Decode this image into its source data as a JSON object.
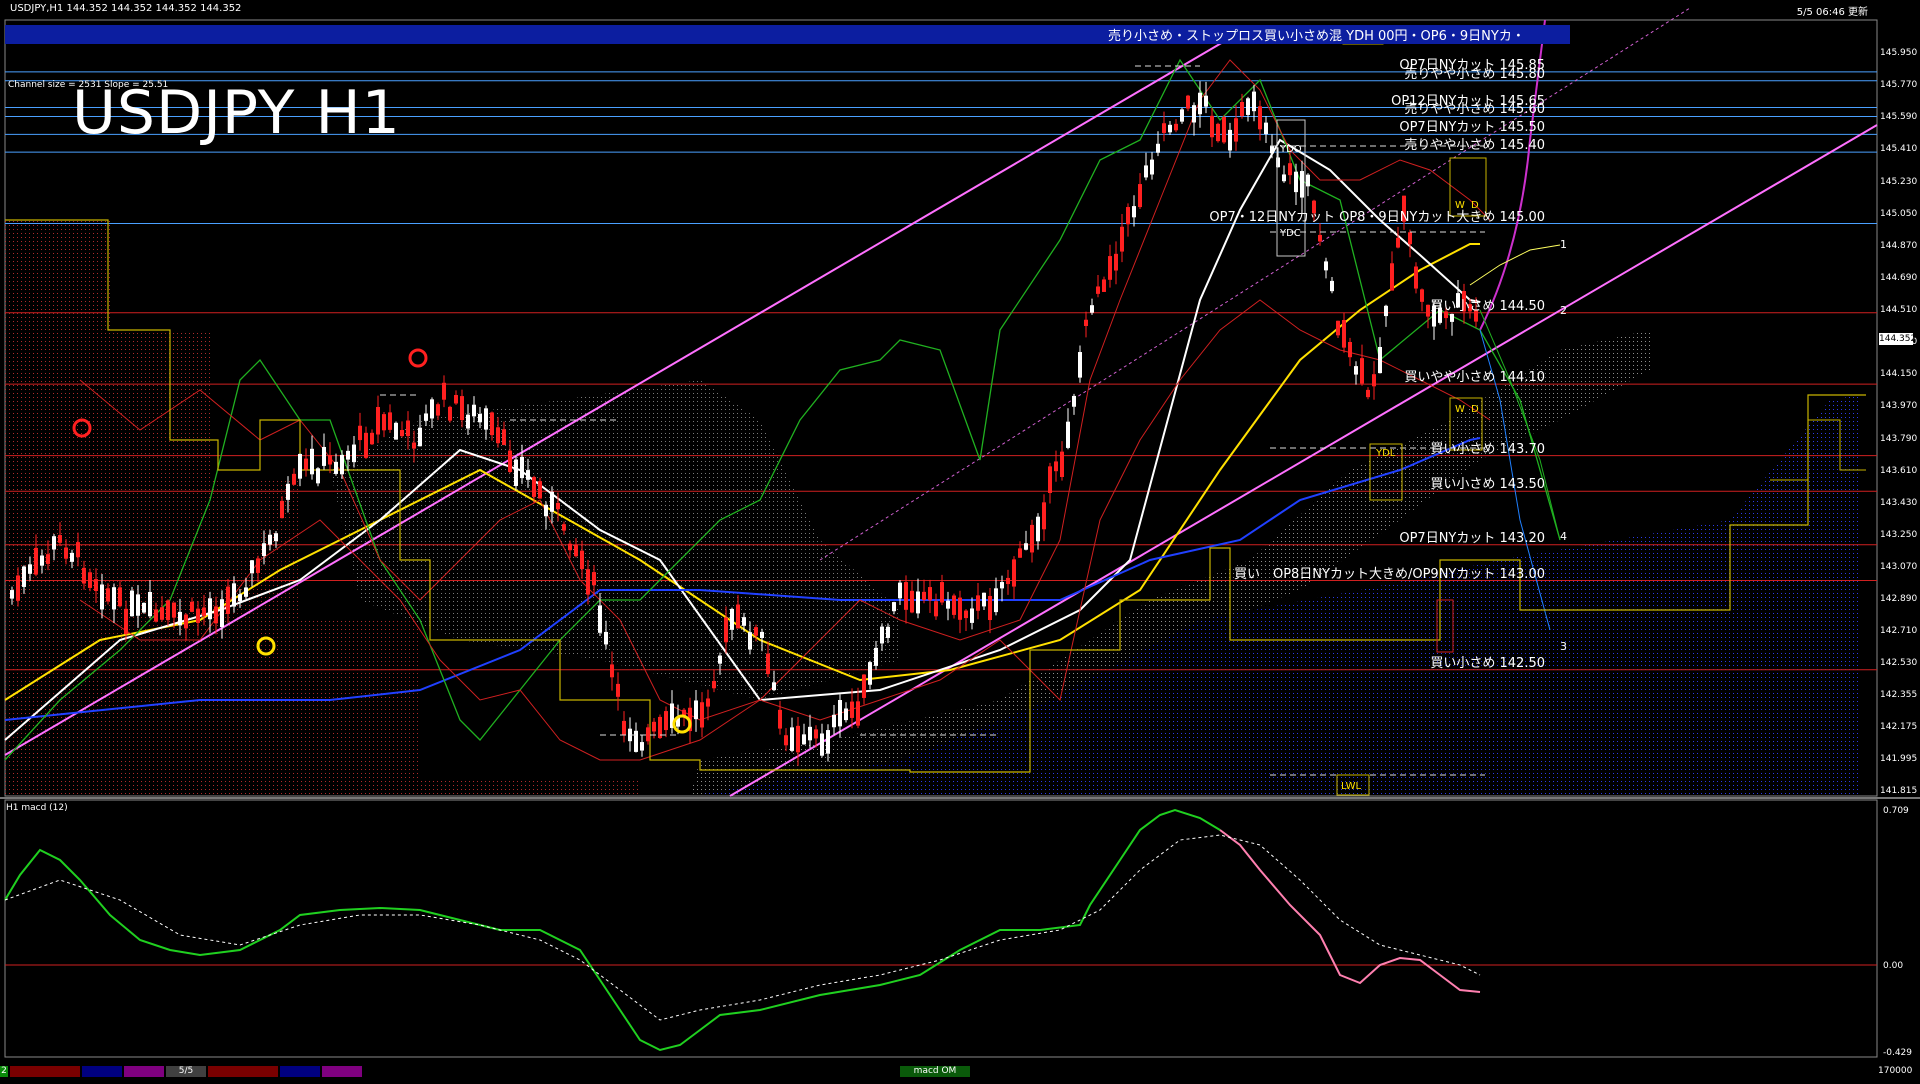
{
  "header": {
    "symbol_line": "USDJPY,H1  144.352 144.352 144.352 144.352",
    "date_label": "5/5 06:46 更新"
  },
  "title": "USDJPY H1",
  "channel_info": "Channel size = 2531 Slope = 25.51",
  "banner_text": "売り小さめ・ストップロス買い小さめ混 YDH 00円・OP6・9日NYカ・",
  "levels": [
    {
      "price": 145.85,
      "label": "OP7日NYカット 145.85",
      "color": "#4aa0ff"
    },
    {
      "price": 145.8,
      "label": "売りやや小さめ 145.80",
      "color": "#4aa0ff"
    },
    {
      "price": 145.65,
      "label": "OP12日NYカット 145.65",
      "color": "#4aa0ff"
    },
    {
      "price": 145.6,
      "label": "売りやや小さめ 145.60",
      "color": "#4aa0ff"
    },
    {
      "price": 145.5,
      "label": "OP7日NYカット 145.50",
      "color": "#4aa0ff"
    },
    {
      "price": 145.4,
      "label": "売りやや小さめ 145.40",
      "color": "#4aa0ff"
    },
    {
      "price": 145.0,
      "label": "OP7・12日NYカット OP8・9日NYカット大きめ 145.00",
      "color": "#4aa0ff"
    },
    {
      "price": 144.5,
      "label": "買い小さめ 144.50",
      "color": "#d02020"
    },
    {
      "price": 144.1,
      "label": "買いやや小さめ 144.10",
      "color": "#d02020"
    },
    {
      "price": 143.7,
      "label": "買い小さめ 143.70",
      "color": "#d02020"
    },
    {
      "price": 143.5,
      "label": "買い小さめ 143.50",
      "color": "#d02020"
    },
    {
      "price": 143.2,
      "label": "OP7日NYカット 143.20",
      "color": "#d02020"
    },
    {
      "price": 143.0,
      "label": "買い　OP8日NYカット大きめ/OP9NYカット 143.00",
      "color": "#d02020"
    },
    {
      "price": 142.5,
      "label": "買い小さめ 142.50",
      "color": "#d02020"
    }
  ],
  "y_axis_ticks": [
    "145.950",
    "145.770",
    "145.590",
    "145.410",
    "145.230",
    "145.050",
    "144.870",
    "144.690",
    "144.510",
    "144.330",
    "144.150",
    "143.970",
    "143.790",
    "143.610",
    "143.430",
    "143.250",
    "143.070",
    "142.890",
    "142.710",
    "142.530",
    "142.355",
    "142.175",
    "141.995",
    "141.815"
  ],
  "current_price": "144.352",
  "markers": {
    "ydo": "YDO",
    "ydc": "YDC",
    "ydl": "YDL",
    "lwl": "LWL",
    "ydh": "YDH",
    "w": "W",
    "d": "D"
  },
  "projection_labels": [
    "1",
    "2",
    "3",
    "4"
  ],
  "macd": {
    "name": "H1  macd (12)",
    "ticks": [
      "0.709",
      "0.00",
      "-0.429"
    ],
    "footer_label": "macd OM"
  },
  "footer": {
    "left_label": "2",
    "tab_label": "5/5",
    "right_label": "170000"
  },
  "chart_data": {
    "type": "candlestick",
    "title": "USDJPY H1",
    "ylim": [
      141.815,
      145.95
    ],
    "horizontal_levels": [
      145.85,
      145.8,
      145.65,
      145.6,
      145.5,
      145.4,
      145.0,
      144.5,
      144.1,
      143.7,
      143.5,
      143.2,
      143.0,
      142.5
    ],
    "last_price": 144.352,
    "macd_range": [
      -0.429,
      0.709
    ]
  }
}
